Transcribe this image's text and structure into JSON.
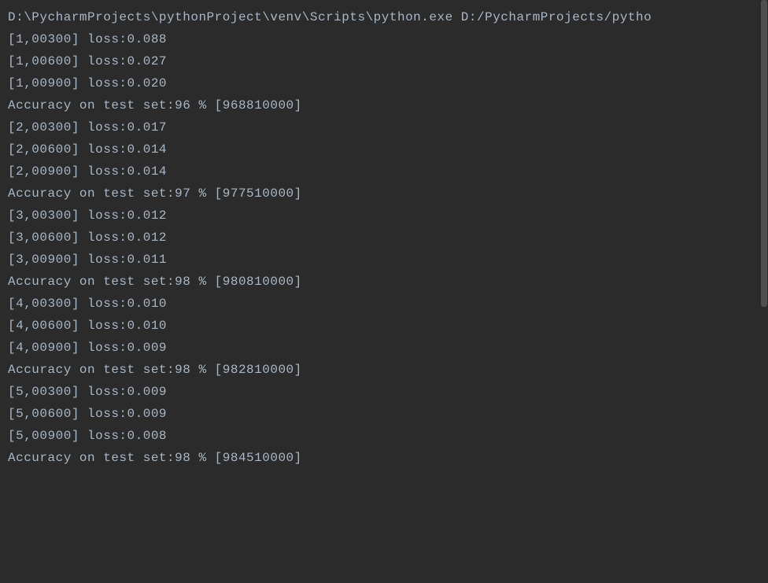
{
  "console": {
    "lines": [
      "D:\\PycharmProjects\\pythonProject\\venv\\Scripts\\python.exe D:/PycharmProjects/pytho",
      "[1,00300] loss:0.088",
      "[1,00600] loss:0.027",
      "[1,00900] loss:0.020",
      "Accuracy on test set:96 % [968810000]",
      "[2,00300] loss:0.017",
      "[2,00600] loss:0.014",
      "[2,00900] loss:0.014",
      "Accuracy on test set:97 % [977510000]",
      "[3,00300] loss:0.012",
      "[3,00600] loss:0.012",
      "[3,00900] loss:0.011",
      "Accuracy on test set:98 % [980810000]",
      "[4,00300] loss:0.010",
      "[4,00600] loss:0.010",
      "[4,00900] loss:0.009",
      "Accuracy on test set:98 % [982810000]",
      "[5,00300] loss:0.009",
      "[5,00600] loss:0.009",
      "[5,00900] loss:0.008",
      "Accuracy on test set:98 % [984510000]"
    ]
  }
}
